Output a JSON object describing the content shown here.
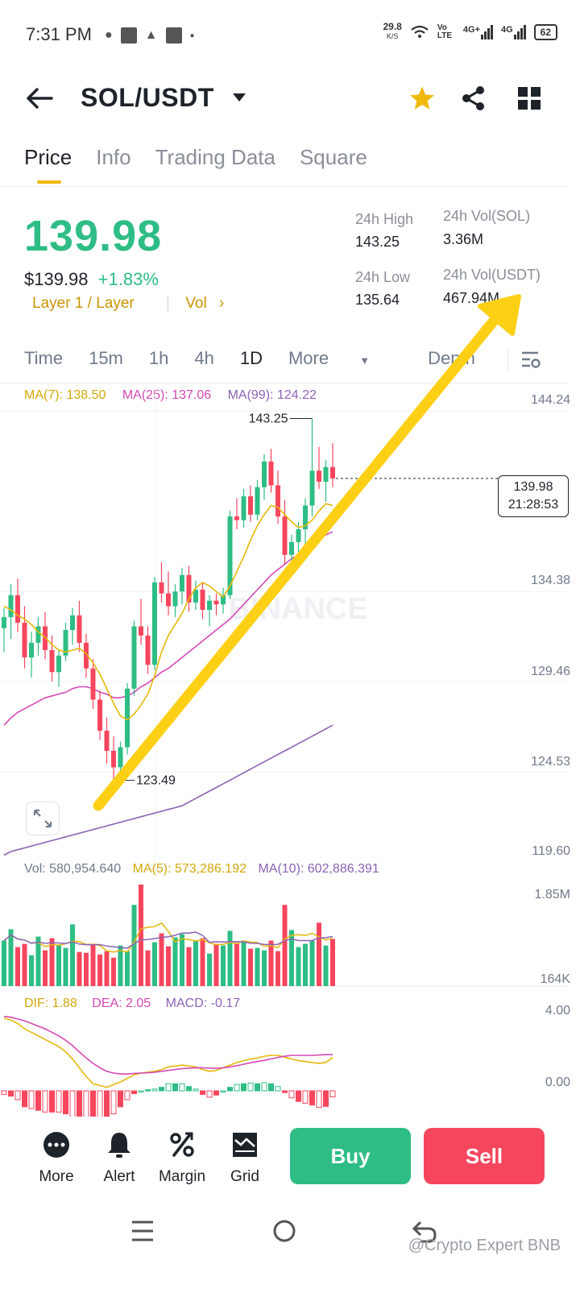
{
  "status": {
    "time": "7:31 PM",
    "speed": "29.8",
    "speed_unit": "K/S",
    "volte": "Vo LTE",
    "net1": "4G+",
    "net2": "4G",
    "battery": "62"
  },
  "header": {
    "pair": "SOL/USDT",
    "icons": [
      "back-arrow-icon",
      "dropdown-triangle-icon",
      "star-icon",
      "share-icon",
      "grid-icon"
    ]
  },
  "tabs": [
    {
      "label": "Price",
      "active": true
    },
    {
      "label": "Info"
    },
    {
      "label": "Trading Data"
    },
    {
      "label": "Square"
    }
  ],
  "ticker": {
    "price": "139.98",
    "usd_price": "$139.98",
    "change": "+1.83%",
    "tags": "Layer 1 / Layer",
    "vol_link": "Vol",
    "high_label": "24h High",
    "high": "143.25",
    "low_label": "24h Low",
    "low": "135.64",
    "vol_sol_label": "24h Vol(SOL)",
    "vol_sol": "3.36M",
    "vol_usdt_label": "24h Vol(USDT)",
    "vol_usdt": "467.94M"
  },
  "intervals": [
    "Time",
    "15m",
    "1h",
    "4h",
    "1D",
    "More",
    "Depth"
  ],
  "colors": {
    "up": "#2ebd85",
    "down": "#f6465d",
    "ma7": "#e5b80b",
    "ma25": "#d548b5",
    "ma99": "#8b63b5",
    "accent": "#f0b90b",
    "annotation_arrow": "#fdd016"
  },
  "chart_data": {
    "type": "candlestick",
    "ma_labels": {
      "ma7": "MA(7): 138.50",
      "ma25": "MA(25): 137.06",
      "ma99": "MA(99): 124.22"
    },
    "y_ticks": [
      "144.24",
      "134.38",
      "129.46",
      "124.53",
      "119.60"
    ],
    "ylim": [
      119.6,
      144.24
    ],
    "current_price": "139.98",
    "countdown": "21:28:53",
    "high_marker": "143.25",
    "low_marker": "123.49",
    "watermark": "BINANCE",
    "candles": [
      [
        131.8,
        132.9,
        130.5,
        132.4
      ],
      [
        132.4,
        134.2,
        131.2,
        133.6
      ],
      [
        133.6,
        134.5,
        131.6,
        132.1
      ],
      [
        132.1,
        133.0,
        129.6,
        130.2
      ],
      [
        130.2,
        131.6,
        129.1,
        131.0
      ],
      [
        131.0,
        132.4,
        130.3,
        131.9
      ],
      [
        131.9,
        132.7,
        130.1,
        130.6
      ],
      [
        130.6,
        131.4,
        128.9,
        129.4
      ],
      [
        129.4,
        130.6,
        128.6,
        130.3
      ],
      [
        130.3,
        132.1,
        130.0,
        131.7
      ],
      [
        131.7,
        132.9,
        130.9,
        132.5
      ],
      [
        132.5,
        133.3,
        130.5,
        131.0
      ],
      [
        131.0,
        131.5,
        129.1,
        129.6
      ],
      [
        129.6,
        130.1,
        127.4,
        127.9
      ],
      [
        127.9,
        128.4,
        125.7,
        126.2
      ],
      [
        126.2,
        126.9,
        124.4,
        125.1
      ],
      [
        125.1,
        125.9,
        123.49,
        124.2
      ],
      [
        124.2,
        125.6,
        123.7,
        125.3
      ],
      [
        125.3,
        128.8,
        124.9,
        128.5
      ],
      [
        128.5,
        132.2,
        128.1,
        131.9
      ],
      [
        131.9,
        133.4,
        130.9,
        131.4
      ],
      [
        131.4,
        131.9,
        129.3,
        129.8
      ],
      [
        129.8,
        134.6,
        129.5,
        134.3
      ],
      [
        134.3,
        135.4,
        133.2,
        133.7
      ],
      [
        133.7,
        134.9,
        132.5,
        133.0
      ],
      [
        133.0,
        134.2,
        132.4,
        133.8
      ],
      [
        133.8,
        135.1,
        133.1,
        134.7
      ],
      [
        134.7,
        135.2,
        132.7,
        133.2
      ],
      [
        133.2,
        134.4,
        132.8,
        133.9
      ],
      [
        133.9,
        134.3,
        132.3,
        132.8
      ],
      [
        132.8,
        133.6,
        131.9,
        133.3
      ],
      [
        133.3,
        133.7,
        132.5,
        133.1
      ],
      [
        133.1,
        134.0,
        132.6,
        133.6
      ],
      [
        133.6,
        138.2,
        133.4,
        137.9
      ],
      [
        137.9,
        138.9,
        137.2,
        137.7
      ],
      [
        137.7,
        139.4,
        137.3,
        139.0
      ],
      [
        139.0,
        139.6,
        137.6,
        138.0
      ],
      [
        138.0,
        139.9,
        137.7,
        139.5
      ],
      [
        139.5,
        141.3,
        138.8,
        140.9
      ],
      [
        140.9,
        141.6,
        139.2,
        139.6
      ],
      [
        139.6,
        140.4,
        137.5,
        137.9
      ],
      [
        137.9,
        138.8,
        135.3,
        135.8
      ],
      [
        135.8,
        136.9,
        135.2,
        136.5
      ],
      [
        136.5,
        137.6,
        135.6,
        137.2
      ],
      [
        137.2,
        138.9,
        136.4,
        138.5
      ],
      [
        138.5,
        143.25,
        137.9,
        140.4
      ],
      [
        140.4,
        141.7,
        139.4,
        139.8
      ],
      [
        139.8,
        141.0,
        138.7,
        140.6
      ],
      [
        140.6,
        141.9,
        139.5,
        139.98
      ]
    ],
    "ma7": [
      133.0,
      132.8,
      132.5,
      132.3,
      132.0,
      131.6,
      131.3,
      130.9,
      130.6,
      130.5,
      130.6,
      130.7,
      130.4,
      129.9,
      129.3,
      128.5,
      127.7,
      127.0,
      126.8,
      127.1,
      127.6,
      128.2,
      129.2,
      130.5,
      131.4,
      132.0,
      132.6,
      133.4,
      134.0,
      134.3,
      134.1,
      133.8,
      133.5,
      134.1,
      134.9,
      135.7,
      136.6,
      137.4,
      138.0,
      138.5,
      138.4,
      138.0,
      137.6,
      137.3,
      137.4,
      137.7,
      138.2,
      138.6,
      138.5
    ],
    "ma25": [
      126.5,
      126.9,
      127.2,
      127.4,
      127.6,
      127.8,
      128.0,
      128.1,
      128.2,
      128.3,
      128.5,
      128.6,
      128.6,
      128.5,
      128.3,
      128.2,
      128.0,
      128.0,
      128.1,
      128.3,
      128.6,
      128.8,
      129.1,
      129.4,
      129.6,
      129.9,
      130.2,
      130.5,
      130.8,
      131.1,
      131.4,
      131.7,
      132.0,
      132.3,
      132.7,
      133.1,
      133.5,
      133.9,
      134.3,
      134.7,
      135.0,
      135.3,
      135.6,
      135.8,
      136.0,
      136.3,
      136.6,
      136.9,
      137.06
    ],
    "ma99": [
      119.4,
      119.6,
      119.7,
      119.8,
      119.9,
      120.0,
      120.1,
      120.2,
      120.3,
      120.4,
      120.5,
      120.6,
      120.7,
      120.8,
      120.9,
      121.0,
      121.1,
      121.2,
      121.3,
      121.4,
      121.5,
      121.6,
      121.7,
      121.8,
      121.9,
      122.0,
      122.1,
      122.3,
      122.5,
      122.7,
      122.9,
      123.1,
      123.3,
      123.5,
      123.7,
      123.9,
      124.1,
      124.3,
      124.5,
      124.7,
      124.9,
      125.1,
      125.3,
      125.5,
      125.7,
      125.9,
      126.1,
      126.3,
      126.5
    ],
    "volume": {
      "labels": {
        "vol": "Vol: 580,954.640",
        "ma5": "MA(5): 573,286.192",
        "ma10": "MA(10): 602,886.391"
      },
      "y_ticks": [
        "1.85M",
        "164K"
      ],
      "ylim": [
        164000,
        1850000
      ],
      "values": [
        560,
        700,
        480,
        520,
        380,
        610,
        440,
        590,
        500,
        470,
        760,
        420,
        410,
        520,
        390,
        430,
        350,
        500,
        430,
        1000,
        1250,
        440,
        540,
        650,
        490,
        600,
        640,
        480,
        560,
        590,
        400,
        520,
        500,
        680,
        520,
        560,
        460,
        470,
        440,
        560,
        430,
        1000,
        690,
        480,
        520,
        560,
        780,
        500,
        580
      ]
    },
    "macd": {
      "labels": {
        "dif": "DIF: 1.88",
        "dea": "DEA: 2.05",
        "macd": "MACD: -0.17"
      },
      "y_ticks": [
        "4.00",
        "0.00"
      ],
      "dif": [
        4.1,
        4.0,
        3.8,
        3.5,
        3.3,
        3.1,
        2.9,
        2.7,
        2.5,
        2.2,
        1.8,
        1.3,
        0.8,
        0.4,
        0.3,
        0.2,
        0.35,
        0.5,
        0.7,
        0.9,
        1.0,
        1.05,
        1.1,
        1.2,
        1.35,
        1.4,
        1.45,
        1.4,
        1.35,
        1.2,
        1.1,
        1.15,
        1.3,
        1.45,
        1.6,
        1.7,
        1.8,
        1.85,
        1.95,
        2.0,
        2.0,
        1.9,
        1.8,
        1.7,
        1.65,
        1.6,
        1.55,
        1.6,
        1.88
      ],
      "dea": [
        4.2,
        4.15,
        4.05,
        3.95,
        3.8,
        3.65,
        3.5,
        3.3,
        3.1,
        2.85,
        2.55,
        2.2,
        1.85,
        1.55,
        1.3,
        1.1,
        1.0,
        0.95,
        0.95,
        0.98,
        1.0,
        1.02,
        1.05,
        1.1,
        1.15,
        1.2,
        1.25,
        1.28,
        1.3,
        1.3,
        1.28,
        1.27,
        1.3,
        1.35,
        1.42,
        1.5,
        1.58,
        1.65,
        1.72,
        1.8,
        1.88,
        1.95,
        2.0,
        2.0,
        2.0,
        2.0,
        2.02,
        2.04,
        2.05
      ]
    }
  },
  "bottom_bar": {
    "more": "More",
    "alert": "Alert",
    "margin": "Margin",
    "grid": "Grid",
    "buy": "Buy",
    "sell": "Sell"
  },
  "footer_watermark": "@Crypto Expert BNB"
}
